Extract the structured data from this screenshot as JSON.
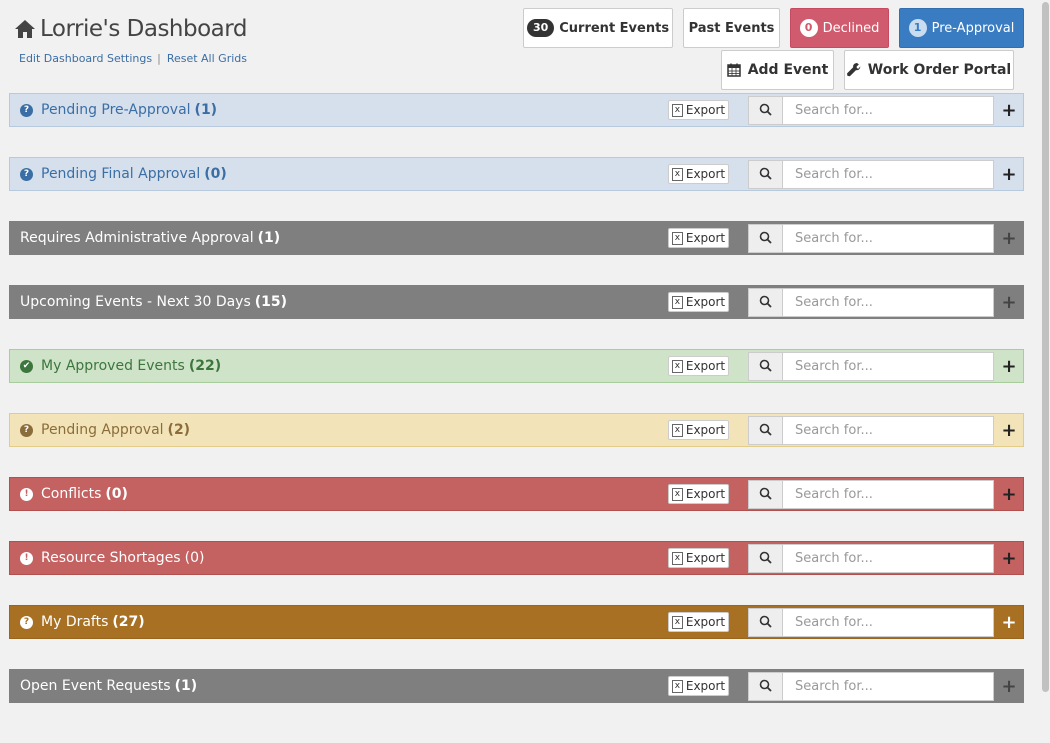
{
  "header": {
    "title": "Lorrie's Dashboard",
    "edit_settings": "Edit Dashboard Settings",
    "separator": "|",
    "reset_grids": "Reset All Grids"
  },
  "top_buttons": {
    "current_events": {
      "count": "30",
      "label": "Current Events"
    },
    "past_events": {
      "label": "Past Events"
    },
    "declined": {
      "count": "0",
      "label": "Declined"
    },
    "pre_approval": {
      "count": "1",
      "label": "Pre-Approval"
    },
    "add_event": {
      "label": "Add Event"
    },
    "work_order_portal": {
      "label": "Work Order Portal"
    }
  },
  "common": {
    "export_label": "Export",
    "search_placeholder": "Search for..."
  },
  "panels": [
    {
      "title": "Pending Pre-Approval",
      "count": "(1)"
    },
    {
      "title": "Pending Final Approval",
      "count": "(0)"
    },
    {
      "title": "Requires Administrative Approval",
      "count": "(1)"
    },
    {
      "title": "Upcoming Events - Next 30 Days",
      "count": "(15)"
    },
    {
      "title": "My Approved Events",
      "count": "(22)"
    },
    {
      "title": "Pending Approval",
      "count": "(2)"
    },
    {
      "title": "Conflicts",
      "count": "(0)"
    },
    {
      "title": "Resource Shortages",
      "count": "(0)"
    },
    {
      "title": "My Drafts",
      "count": "(27)"
    },
    {
      "title": "Open Event Requests",
      "count": "(1)"
    }
  ],
  "icons": {
    "question": "?",
    "check": "✔",
    "exclamation": "!",
    "plus": "+"
  },
  "colors": {
    "declined": "#d05a6e",
    "pre_approval": "#3a7cc2",
    "blue_panel": "#d6e0ec",
    "gray_panel": "#7f7f7f",
    "green_panel": "#cfe3c8",
    "yellow_panel": "#f2e4b8",
    "red_panel": "#c46161",
    "brown_panel": "#a87022"
  }
}
